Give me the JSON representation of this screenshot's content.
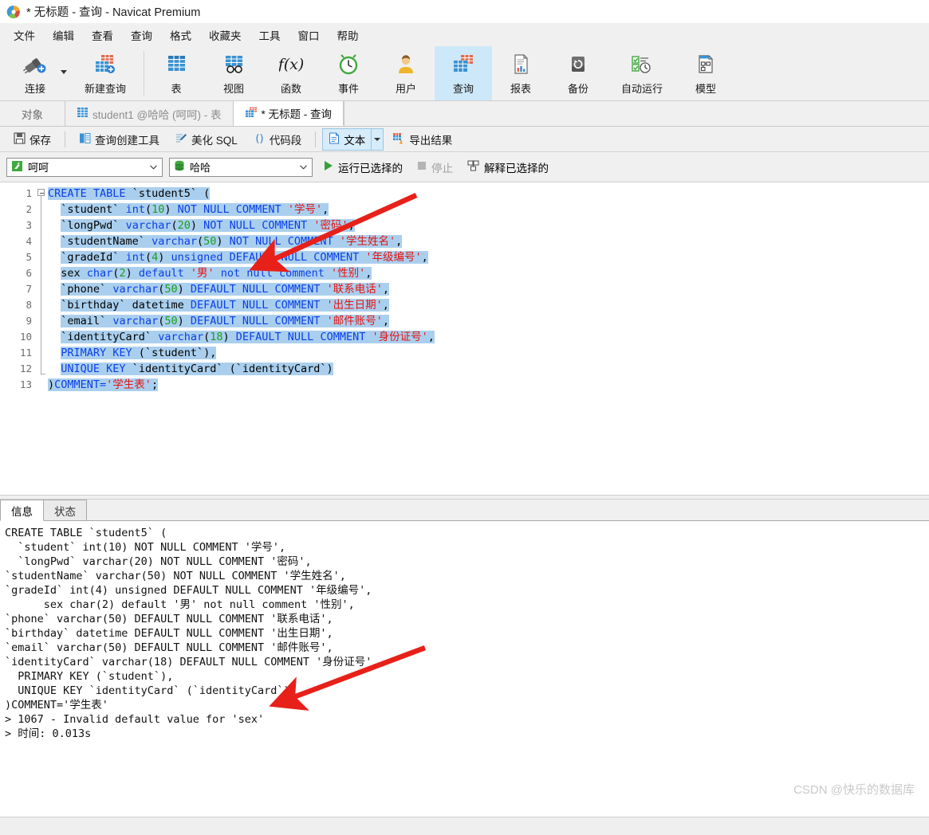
{
  "window": {
    "title": "* 无标题 - 查询 - Navicat Premium",
    "app_icon": "navicat-logo-icon"
  },
  "menubar": {
    "items": [
      {
        "label": "文件"
      },
      {
        "label": "编辑"
      },
      {
        "label": "查看"
      },
      {
        "label": "查询"
      },
      {
        "label": "格式"
      },
      {
        "label": "收藏夹"
      },
      {
        "label": "工具"
      },
      {
        "label": "窗口"
      },
      {
        "label": "帮助"
      }
    ]
  },
  "toolbar": {
    "items": [
      {
        "label": "连接",
        "icon": "connection-plug-icon",
        "active": false,
        "has_caret": true
      },
      {
        "label": "新建查询",
        "icon": "new-query-table-icon",
        "active": false
      },
      {
        "label": "表",
        "icon": "table-grid-icon",
        "active": false
      },
      {
        "label": "视图",
        "icon": "view-glasses-icon",
        "active": false
      },
      {
        "label": "函数",
        "icon": "function-fx-icon",
        "active": false
      },
      {
        "label": "事件",
        "icon": "event-clock-icon",
        "active": false
      },
      {
        "label": "用户",
        "icon": "user-person-icon",
        "active": false
      },
      {
        "label": "查询",
        "icon": "query-table-icon",
        "active": true
      },
      {
        "label": "报表",
        "icon": "report-document-icon",
        "active": false
      },
      {
        "label": "备份",
        "icon": "backup-drive-icon",
        "active": false
      },
      {
        "label": "自动运行",
        "icon": "automation-check-clock-icon",
        "active": false
      },
      {
        "label": "模型",
        "icon": "model-diagram-icon",
        "active": false
      }
    ]
  },
  "tabstrip": {
    "object_label": "对象",
    "tabs": [
      {
        "label": "student1 @哈哈 (呵呵) - 表",
        "icon": "table-grid-icon",
        "active": false
      },
      {
        "label": "* 无标题 - 查询",
        "icon": "query-table-icon",
        "active": true
      }
    ]
  },
  "querybar": {
    "save": "保存",
    "query_builder": "查询创建工具",
    "beautify_sql": "美化 SQL",
    "code_snippet": "代码段",
    "text_mode": "文本",
    "export_result": "导出结果"
  },
  "connbar": {
    "connection": "呵呵",
    "database": "哈哈",
    "run_selected": "运行已选择的",
    "stop": "停止",
    "stop_disabled": true,
    "explain_selected": "解释已选择的"
  },
  "editor": {
    "line_numbers": [
      "1",
      "2",
      "3",
      "4",
      "5",
      "6",
      "7",
      "8",
      "9",
      "10",
      "11",
      "12",
      "13"
    ],
    "lines": [
      "CREATE TABLE `student5` (",
      "  `student` int(10) NOT NULL COMMENT '学号',",
      "  `longPwd` varchar(20) NOT NULL COMMENT '密码',",
      "  `studentName` varchar(50) NOT NULL COMMENT '学生姓名',",
      "  `gradeId` int(4) unsigned DEFAULT NULL COMMENT '年级编号',",
      "  sex char(2) default '男' not null comment '性别',",
      "  `phone` varchar(50) DEFAULT NULL COMMENT '联系电话',",
      "  `birthday` datetime DEFAULT NULL COMMENT '出生日期',",
      "  `email` varchar(50) DEFAULT NULL COMMENT '邮件账号',",
      "  `identityCard` varchar(18) DEFAULT NULL COMMENT '身份证号',",
      "  PRIMARY KEY (`student`),",
      "  UNIQUE KEY `identityCard` (`identityCard`)",
      ")COMMENT='学生表';"
    ]
  },
  "results": {
    "tabs": [
      {
        "label": "信息",
        "active": true
      },
      {
        "label": "状态",
        "active": false
      }
    ],
    "output_lines": [
      "CREATE TABLE `student5` (",
      "  `student` int(10) NOT NULL COMMENT '学号',",
      "  `longPwd` varchar(20) NOT NULL COMMENT '密码',",
      "`studentName` varchar(50) NOT NULL COMMENT '学生姓名',",
      "`gradeId` int(4) unsigned DEFAULT NULL COMMENT '年级编号',",
      "      sex char(2) default '男' not null comment '性别',",
      "`phone` varchar(50) DEFAULT NULL COMMENT '联系电话',",
      "`birthday` datetime DEFAULT NULL COMMENT '出生日期',",
      "`email` varchar(50) DEFAULT NULL COMMENT '邮件账号',",
      "`identityCard` varchar(18) DEFAULT NULL COMMENT '身份证号',",
      "  PRIMARY KEY (`student`),",
      "  UNIQUE KEY `identityCard` (`identityCard`)",
      ")COMMENT='学生表'",
      "> 1067 - Invalid default value for 'sex'",
      "> 时间: 0.013s"
    ]
  },
  "annotations": {
    "arrow_color": "#e8201a",
    "arrows": [
      "arrow-pointing-to-sex-line-editor",
      "arrow-pointing-to-error-message"
    ]
  },
  "watermark": {
    "text": "CSDN @快乐的数据库"
  }
}
